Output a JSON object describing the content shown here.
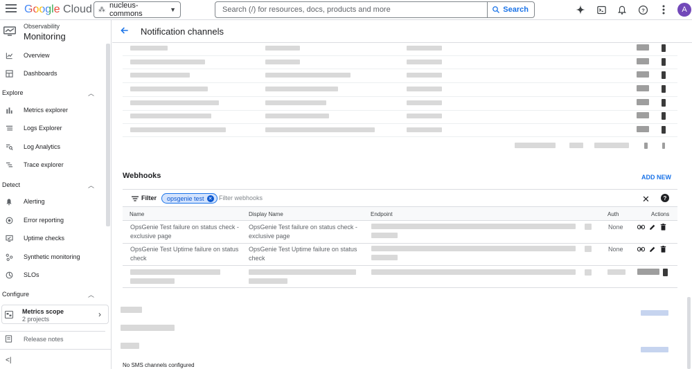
{
  "header": {
    "logo_google": "Google",
    "logo_cloud": "Cloud",
    "project": "nucleus-commons",
    "search_placeholder": "Search (/) for resources, docs, products and more",
    "search_button": "Search",
    "avatar_letter": "A"
  },
  "sidebar": {
    "service_small": "Observability",
    "service_big": "Monitoring",
    "overview": "Overview",
    "dashboards": "Dashboards",
    "explore": "Explore",
    "metrics_explorer": "Metrics explorer",
    "logs_explorer": "Logs Explorer",
    "log_analytics": "Log Analytics",
    "trace_explorer": "Trace explorer",
    "detect": "Detect",
    "alerting": "Alerting",
    "error_reporting": "Error reporting",
    "uptime_checks": "Uptime checks",
    "synthetic_monitoring": "Synthetic monitoring",
    "slos": "SLOs",
    "configure": "Configure",
    "metrics_scope_title": "Metrics scope",
    "metrics_scope_sub": "2 projects",
    "release_notes": "Release notes"
  },
  "page": {
    "title": "Notification channels"
  },
  "webhooks": {
    "title": "Webhooks",
    "add_new": "ADD NEW",
    "filter_label": "Filter",
    "filter_chip": "opsgenie test",
    "filter_placeholder": "Filter webhooks",
    "columns": {
      "name": "Name",
      "display_name": "Display Name",
      "endpoint": "Endpoint",
      "auth": "Auth",
      "actions": "Actions"
    },
    "rows": [
      {
        "name": "OpsGenie Test failure on status check - exclusive page",
        "display_name": "OpsGenie Test failure on status check - exclusive page",
        "auth": "None"
      },
      {
        "name": "OpsGenie Test Uptime failure on status check",
        "display_name": "OpsGenie Test Uptime failure on status check",
        "auth": "None"
      }
    ]
  },
  "sms": {
    "empty": "No SMS channels configured"
  },
  "colors": {
    "accent": "#1a73e8",
    "chip_bg": "#d3e3fd",
    "avatar": "#7248b9"
  }
}
